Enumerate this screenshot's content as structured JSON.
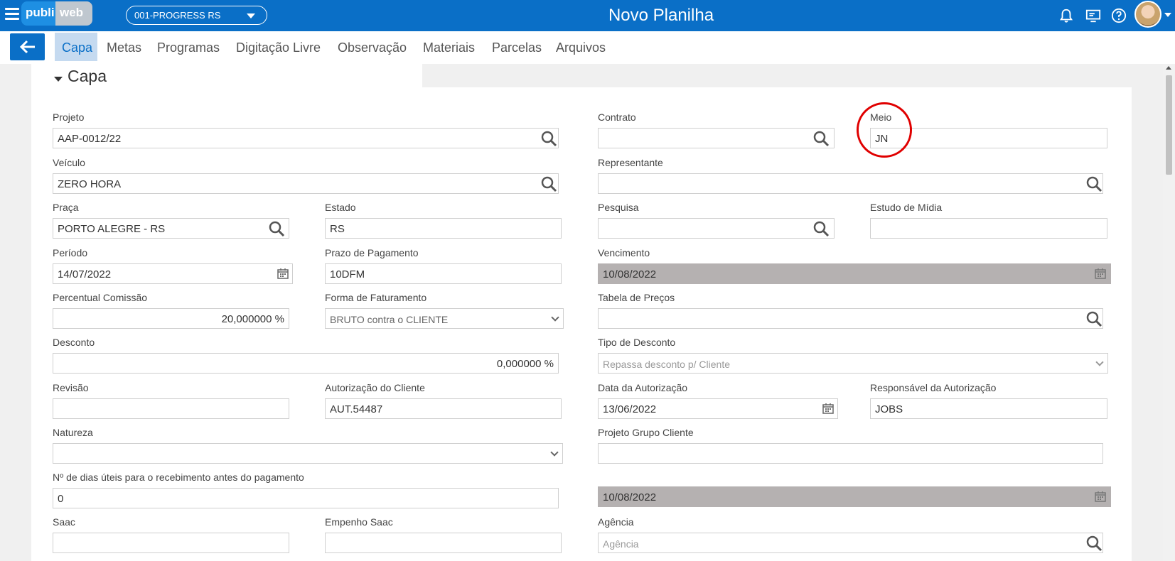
{
  "header": {
    "logo_left": "publi",
    "logo_right": "web",
    "company": "001-PROGRESS RS",
    "title": "Novo Planilha"
  },
  "tabs": [
    "Capa",
    "Metas",
    "Programas",
    "Digitação Livre",
    "Observação",
    "Materiais",
    "Parcelas",
    "Arquivos"
  ],
  "section": {
    "title": "Capa"
  },
  "fields": {
    "projeto": {
      "label": "Projeto",
      "value": "AAP-0012/22"
    },
    "contrato": {
      "label": "Contrato",
      "value": ""
    },
    "meio": {
      "label": "Meio",
      "value": "JN"
    },
    "veiculo": {
      "label": "Veículo",
      "value": "ZERO HORA"
    },
    "representante": {
      "label": "Representante",
      "value": ""
    },
    "praca": {
      "label": "Praça",
      "value": "PORTO ALEGRE - RS"
    },
    "estado": {
      "label": "Estado",
      "value": "RS"
    },
    "pesquisa": {
      "label": "Pesquisa",
      "value": ""
    },
    "estudo_midia": {
      "label": "Estudo de Mídia",
      "value": ""
    },
    "periodo": {
      "label": "Período",
      "value": "14/07/2022"
    },
    "prazo_pagamento": {
      "label": "Prazo de Pagamento",
      "value": "10DFM"
    },
    "vencimento": {
      "label": "Vencimento",
      "value": "10/08/2022"
    },
    "percentual_comissao": {
      "label": "Percentual Comissão",
      "value": "20,000000 %"
    },
    "forma_faturamento": {
      "label": "Forma de Faturamento",
      "value": "BRUTO contra o CLIENTE"
    },
    "tabela_precos": {
      "label": "Tabela de Preços",
      "value": ""
    },
    "desconto": {
      "label": "Desconto",
      "value": "0,000000 %"
    },
    "tipo_desconto": {
      "label": "Tipo de Desconto",
      "value": "Repassa desconto p/ Cliente"
    },
    "revisao": {
      "label": "Revisão",
      "value": ""
    },
    "autorizacao_cliente": {
      "label": "Autorização do Cliente",
      "value": "AUT.54487"
    },
    "data_autorizacao": {
      "label": "Data da Autorização",
      "value": "13/06/2022"
    },
    "responsavel_autorizacao": {
      "label": "Responsável da Autorização",
      "value": "JOBS"
    },
    "natureza": {
      "label": "Natureza",
      "value": ""
    },
    "projeto_grupo_cliente": {
      "label": "Projeto Grupo Cliente",
      "value": ""
    },
    "dias_uteis": {
      "label": "Nº de dias úteis para o recebimento antes do pagamento",
      "value": "0"
    },
    "data_recebimento": {
      "value": "10/08/2022"
    },
    "saac": {
      "label": "Saac",
      "value": ""
    },
    "empenho_saac": {
      "label": "Empenho Saac",
      "value": ""
    },
    "agencia": {
      "label": "Agência",
      "placeholder": "Agência"
    }
  },
  "colors": {
    "primary": "#0a6fc7",
    "active_tab_bg": "#c5daf0",
    "disabled_field": "#b5b1b1",
    "highlight": "#e00000"
  }
}
